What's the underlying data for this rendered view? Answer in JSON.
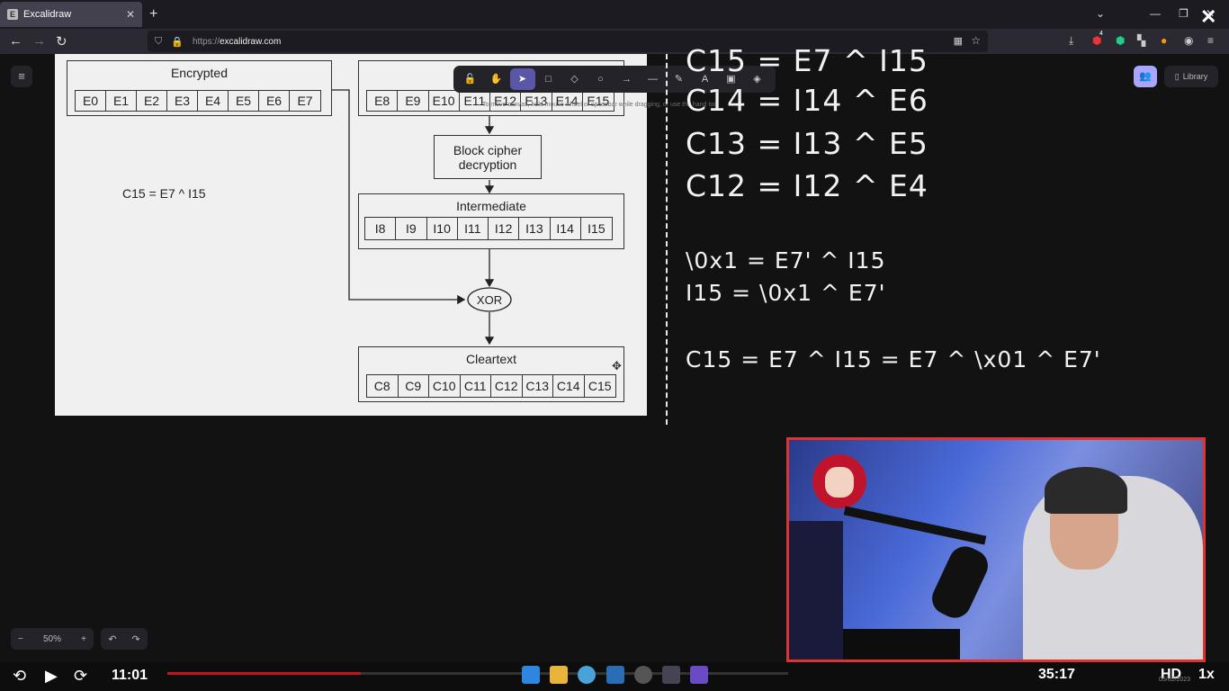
{
  "browser": {
    "tab_title": "Excalidraw",
    "tab_favicon": "E",
    "url_prefix": "https://",
    "url_domain": "excalidraw.com",
    "extension_badge": "4"
  },
  "excalidraw": {
    "tools": [
      {
        "name": "lock-icon",
        "glyph": "🔓",
        "active": false
      },
      {
        "name": "hand-icon",
        "glyph": "✋",
        "active": false
      },
      {
        "name": "selection-icon",
        "glyph": "➤",
        "active": true
      },
      {
        "name": "rectangle-icon",
        "glyph": "□",
        "active": false
      },
      {
        "name": "diamond-icon",
        "glyph": "◇",
        "active": false
      },
      {
        "name": "ellipse-icon",
        "glyph": "○",
        "active": false
      },
      {
        "name": "arrow-icon",
        "glyph": "→",
        "active": false
      },
      {
        "name": "line-icon",
        "glyph": "—",
        "active": false
      },
      {
        "name": "draw-icon",
        "glyph": "✎",
        "active": false
      },
      {
        "name": "text-icon",
        "glyph": "A",
        "active": false
      },
      {
        "name": "image-icon",
        "glyph": "▣",
        "active": false
      },
      {
        "name": "eraser-icon",
        "glyph": "◈",
        "active": false
      }
    ],
    "hint": "To move canvas, hold mouse wheel or spacebar while dragging, or use the hand tool",
    "library_label": "Library",
    "zoom_level": "50%"
  },
  "diagram": {
    "encrypted_label": "Encrypted",
    "encrypted_cells": [
      "E0",
      "E1",
      "E2",
      "E3",
      "E4",
      "E5",
      "E6",
      "E7"
    ],
    "encrypted_cells_2": [
      "E8",
      "E9",
      "E10",
      "E11",
      "E12",
      "E13",
      "E14",
      "E15"
    ],
    "block_cipher_label": "Block cipher decryption",
    "intermediate_label": "Intermediate",
    "intermediate_cells": [
      "I8",
      "I9",
      "I10",
      "I11",
      "I12",
      "I13",
      "I14",
      "I15"
    ],
    "xor_label": "XOR",
    "cleartext_label": "Cleartext",
    "cleartext_cells": [
      "C8",
      "C9",
      "C10",
      "C11",
      "C12",
      "C13",
      "C14",
      "C15"
    ],
    "note": "C15 = E7 ^ I15"
  },
  "equations": {
    "line1": "C15 = E7 ^ I15",
    "line2": "C14 = I14 ^ E6",
    "line3": "C13 = I13 ^ E5",
    "line4": "C12 = I12 ^ E4",
    "line5": "\\0x1 = E7' ^ I15",
    "line6": "I15 = \\0x1 ^ E7'",
    "line7": "C15 = E7 ^ I15 = E7 ^ \\x01 ^ E7'"
  },
  "player": {
    "current_time": "11:01",
    "total_time": "35:17",
    "progress_fraction": 0.312,
    "quality": "HD",
    "speed": "1x",
    "date": "05/02/2023"
  },
  "colors": {
    "accent": "#5b57a8",
    "progress": "#c4141f"
  }
}
